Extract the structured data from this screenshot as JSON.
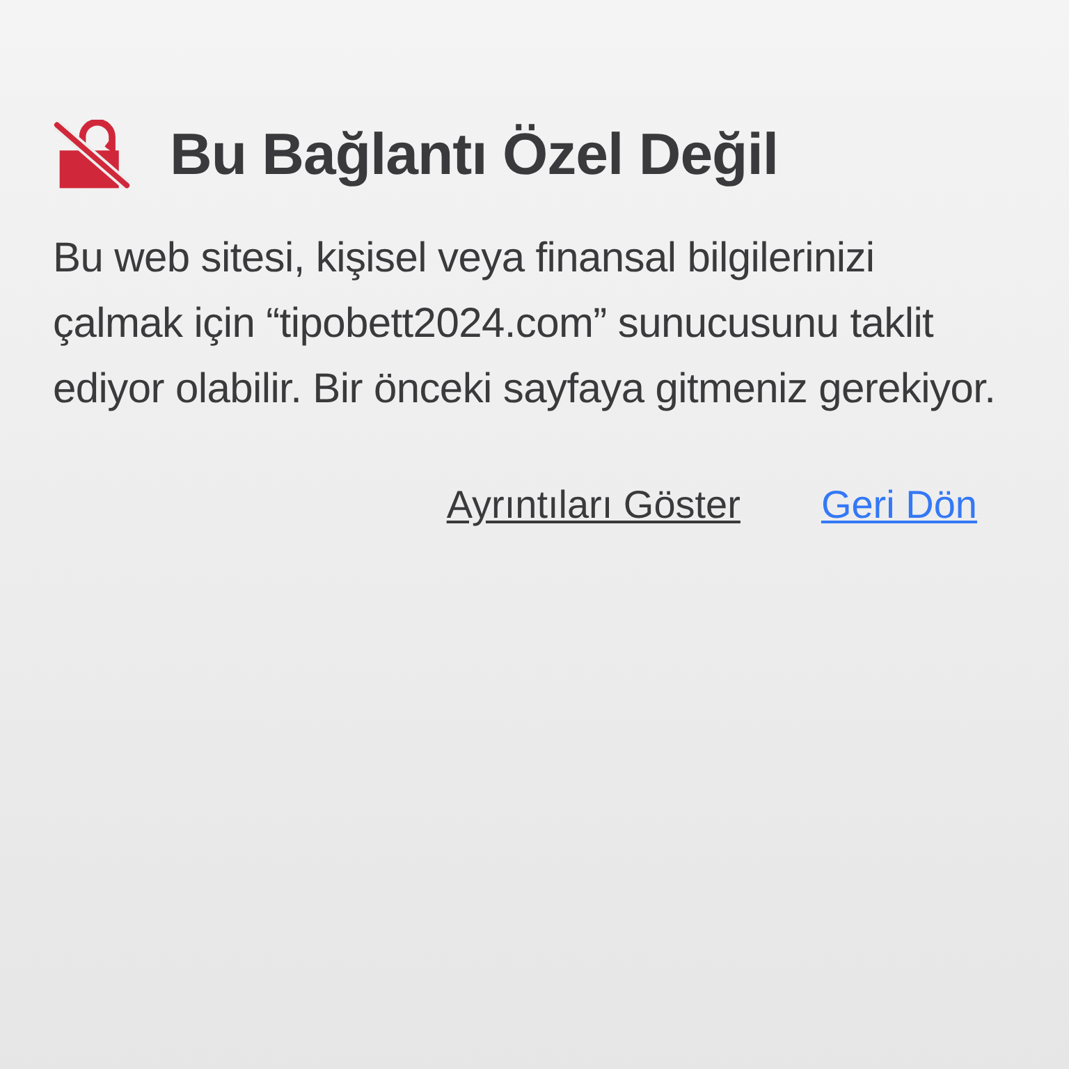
{
  "title": "Bu Bağlantı Özel Değil",
  "message": "Bu web sitesi, kişisel veya finansal bilgilerinizi çalmak için “tipobett2024.com” sunucusunu taklit ediyor olabilir. Bir önceki sayfaya gitmeniz gerekiyor.",
  "links": [
    {
      "label": "Ayrıntıları Göster",
      "kind": "secondary"
    },
    {
      "label": "Geri Dön",
      "kind": "primary"
    }
  ]
}
